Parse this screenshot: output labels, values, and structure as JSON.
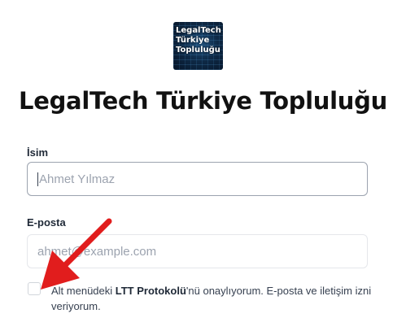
{
  "logo": {
    "lines": [
      "LegalTech",
      "Türkiye",
      "Topluluğu"
    ]
  },
  "page": {
    "title": "LegalTech Türkiye Topluluğu"
  },
  "form": {
    "name_label": "İsim",
    "name_placeholder": "Ahmet Yılmaz",
    "email_label": "E-posta",
    "email_placeholder": "ahmet@example.com",
    "consent": {
      "prefix": "Alt menüdeki ",
      "bold": "LTT Protokolü",
      "suffix": "'nü onaylıyorum. E-posta ve iletişim izni veriyorum.",
      "checked": false
    }
  },
  "annotation": {
    "arrow_color": "#e11d1d"
  }
}
